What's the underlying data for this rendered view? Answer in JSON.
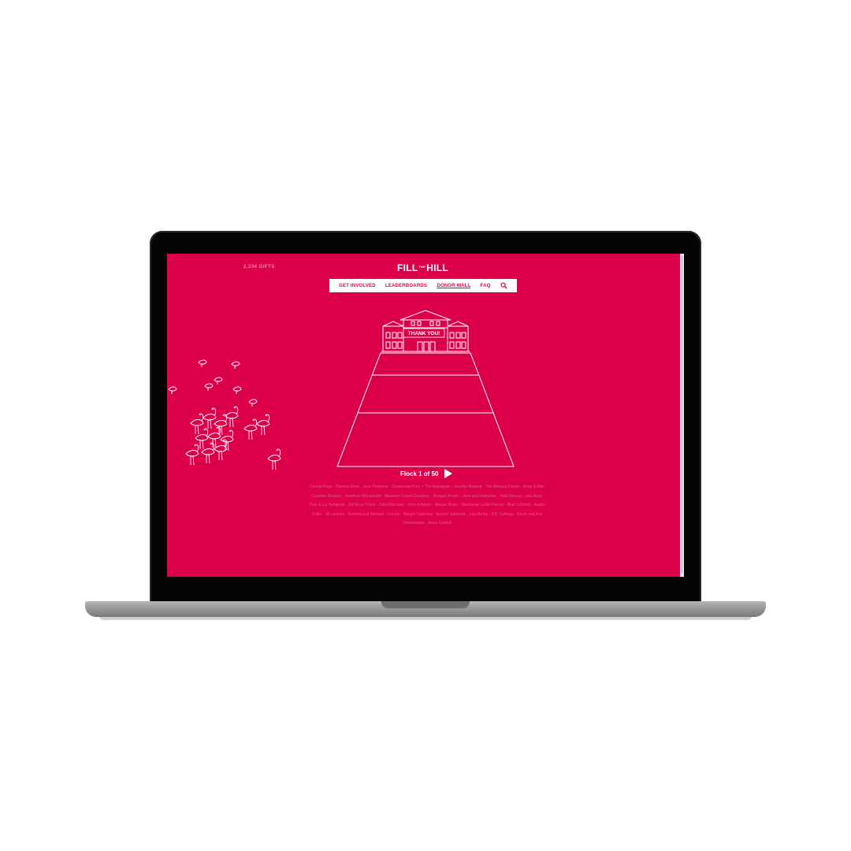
{
  "header": {
    "gift_count": "2,334 GIFTS",
    "logo": {
      "left": "FILL",
      "middle": "THE",
      "right": "HILL"
    }
  },
  "nav": {
    "items": [
      {
        "label": "GET INVOLVED",
        "active": false
      },
      {
        "label": "LEADERBOARDS",
        "active": false
      },
      {
        "label": "DONOR WALL",
        "active": true
      },
      {
        "label": "FAQ",
        "active": false
      }
    ],
    "search_icon": "search-icon"
  },
  "hill": {
    "building_banner": "THANK YOU!"
  },
  "flock": {
    "label": "Flock 1 of 50",
    "next_icon": "play-arrow-icon"
  },
  "donor_names": "Connie Khan · Pamela West · Jane Peterson · Gurbachan Pury + The Applegate · Jennifer Bassett · The Renaud Family · Anne & Alan · Caroline Dodson · Jonathan Macdonald · Maureen Corish Donahue · Morgan Brown · Jens and Katherine · Todd Brocco · Lisa Brian · Pete & Liz Benjamin · Da'Moya Travis · Julia Albertaro · John Ashburn · Megan Bows · Stephanie Gable-Pienas · Blair Schmidt · Austin Cullie · Jill Leonsio · Rommerical Michael · Conroy · Margot Garbows · Rachel Jablonski · Lisa Burke · P.B. Collings · Kevin and Ann Stonekeeper · Anna Cashell",
  "colors": {
    "brand": "#dc0048",
    "text_light": "#ffffff",
    "laptop_frame": "#050505",
    "laptop_base": "#9a9a9a"
  }
}
